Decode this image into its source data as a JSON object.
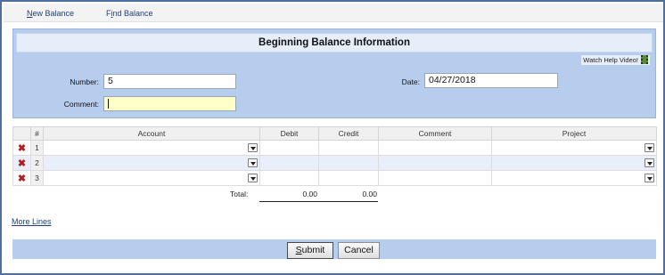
{
  "toolbar": {
    "new_balance_key": "N",
    "new_balance_rest": "ew Balance",
    "find_balance_prefix": "F",
    "find_balance_key": "i",
    "find_balance_rest": "nd Balance"
  },
  "panel": {
    "title": "Beginning Balance Information",
    "help_link": "Watch Help Video!",
    "number_label": "Number:",
    "number_value": "5",
    "comment_label": "Comment:",
    "comment_value": "",
    "date_label": "Date:",
    "date_value": "04/27/2018"
  },
  "grid": {
    "headers": {
      "hash": "#",
      "account": "Account",
      "debit": "Debit",
      "credit": "Credit",
      "comment": "Comment",
      "project": "Project"
    },
    "rows": [
      {
        "num": "1",
        "delete_icon": "✖"
      },
      {
        "num": "2",
        "delete_icon": "✖"
      },
      {
        "num": "3",
        "delete_icon": "✖"
      }
    ],
    "total_label": "Total:",
    "total_debit": "0.00",
    "total_credit": "0.00"
  },
  "more_lines": "More Lines",
  "buttons": {
    "submit_key": "S",
    "submit_rest": "ubmit",
    "cancel": "Cancel"
  },
  "colors": {
    "panel_bg": "#b7cdee",
    "frame_border": "#4e6fa1",
    "delete_red": "#b12020",
    "link_blue": "#1f3f7a"
  }
}
